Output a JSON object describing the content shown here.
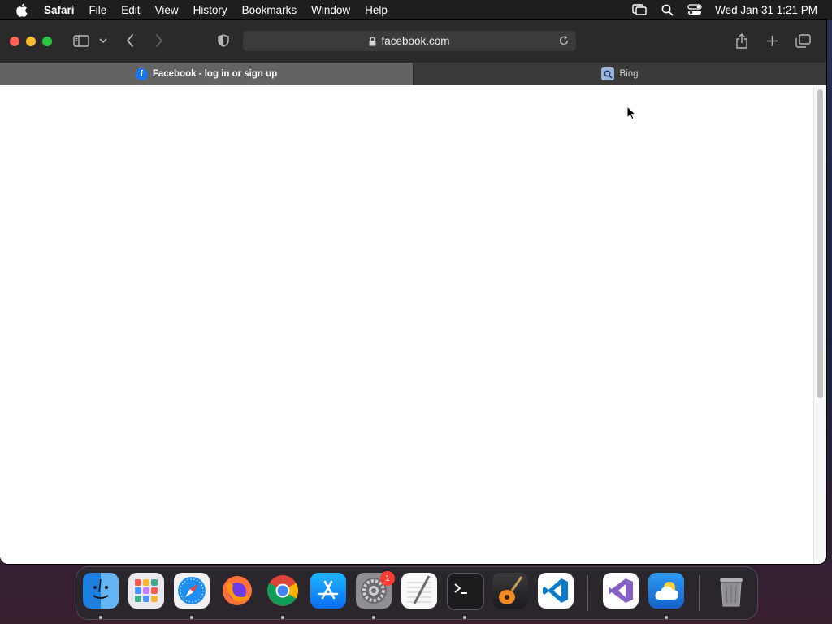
{
  "menubar": {
    "app_name": "Safari",
    "items": [
      "File",
      "Edit",
      "View",
      "History",
      "Bookmarks",
      "Window",
      "Help"
    ],
    "datetime": "Wed Jan 31  1:21 PM"
  },
  "browser": {
    "url": "facebook.com",
    "tabs": [
      {
        "title": "Facebook - log in or sign up",
        "active": true,
        "icon": "facebook-icon"
      },
      {
        "title": "Bing",
        "active": false,
        "icon": "bing-search-icon"
      }
    ]
  },
  "dock": {
    "apps": [
      "Finder",
      "Launchpad",
      "Safari",
      "Firefox",
      "Chrome",
      "App Store",
      "System Settings",
      "TextEdit",
      "Terminal",
      "GarageBand",
      "Visual Studio Code",
      "Visual Studio",
      "Weather",
      "Trash"
    ],
    "badges": {
      "system_settings": "1"
    }
  },
  "colors": {
    "accent": "#1877f2",
    "traffic_close": "#ff5f57",
    "traffic_minimize": "#febc2e",
    "traffic_maximize": "#28c840"
  }
}
